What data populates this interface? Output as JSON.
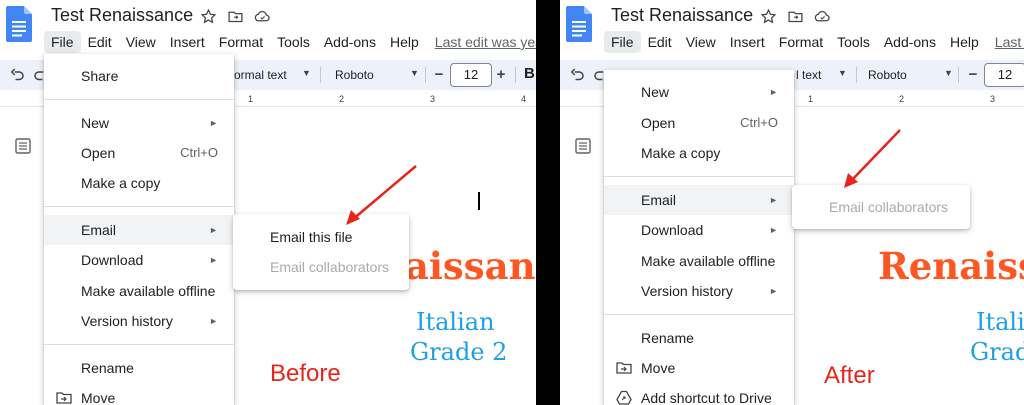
{
  "doc": {
    "title": "Test Renaissance",
    "menu": [
      "File",
      "Edit",
      "View",
      "Insert",
      "Format",
      "Tools",
      "Add-ons",
      "Help"
    ],
    "last_edit_before": "Last edit was yeste",
    "last_edit_after": "Last e"
  },
  "toolbar": {
    "style_before": "ormal text",
    "style_after": "l text",
    "font": "Roboto",
    "font_size": "12",
    "minus": "−",
    "plus": "+",
    "bold": "B"
  },
  "ruler": {
    "ticks": [
      "1",
      "2",
      "3",
      "4"
    ]
  },
  "before": {
    "file_menu": {
      "share": "Share",
      "new": "New",
      "open": "Open",
      "open_shortcut": "Ctrl+O",
      "make_copy": "Make a copy",
      "email": "Email",
      "download": "Download",
      "offline": "Make available offline",
      "version_history": "Version history",
      "rename": "Rename",
      "move": "Move"
    },
    "submenu": {
      "email_file": "Email this file",
      "email_collaborators": "Email collaborators"
    },
    "doc_title_fragment": "naissan",
    "subtitle_line1": "Italian",
    "subtitle_line2": "Grade 2",
    "annotation": "Before"
  },
  "after": {
    "file_menu": {
      "new": "New",
      "open": "Open",
      "open_shortcut": "Ctrl+O",
      "make_copy": "Make a copy",
      "email": "Email",
      "download": "Download",
      "offline": "Make available offline",
      "version_history": "Version history",
      "rename": "Rename",
      "move": "Move",
      "shortcut": "Add shortcut to Drive"
    },
    "submenu": {
      "email_collaborators": "Email collaborators"
    },
    "doc_title_fragment": "Renaiss",
    "subtitle_line1": "Itali",
    "subtitle_line2": "Grad",
    "annotation": "After"
  },
  "colors": {
    "annotation": "#e8251b",
    "title_orange": "#ff5722",
    "subtitle_blue": "#1ea0e6",
    "docs_blue": "#4285f4"
  },
  "icons": [
    "docs-logo-icon",
    "star-icon",
    "folder-move-icon",
    "cloud-status-icon",
    "undo-icon",
    "redo-icon",
    "outline-icon",
    "move-folder-icon",
    "drive-shortcut-icon",
    "red-arrow-icon"
  ]
}
